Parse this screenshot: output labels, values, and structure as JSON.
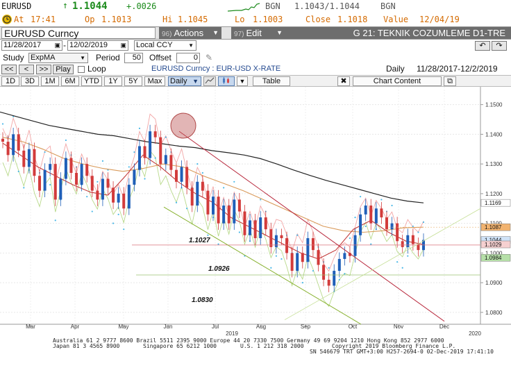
{
  "quote": {
    "ticker": "EURUSD",
    "last": "1.1044",
    "change": "+.0026",
    "bgn_label": "BGN",
    "bidask": "1.1043/1.1044",
    "bgn_label2": "BGN",
    "at_label": "At",
    "time": "17:41",
    "op_label": "Op",
    "open": "1.1013",
    "hi_label": "Hi",
    "high": "1.1045",
    "lo_label": "Lo",
    "low": "1.1003",
    "close_label": "Close",
    "close": "1.1018",
    "value_label": "Value",
    "value_date": "12/04/19"
  },
  "titlebar": {
    "security": "EURUSD Curncy",
    "actions_num": "96)",
    "actions_label": "Actions",
    "edit_num": "97)",
    "edit_label": "Edit",
    "function_title": "G 21: TEKNIK COZUMLEME D1-TRE"
  },
  "controls": {
    "start_date": "11/28/2017",
    "end_date": "12/02/2019",
    "currency": "Local CCY",
    "study_label": "Study",
    "study_value": "ExpMA",
    "period_label": "Period",
    "period_value": "50",
    "offset_label": "Offset",
    "offset_value": "0",
    "play_label": "Play",
    "loop_label": "Loop",
    "chart_subtitle": "EURUSD Curncy : EUR-USD X-RATE",
    "frequency": "Daily",
    "range_text": "11/28/2017-12/2/2019"
  },
  "periods": [
    "1D",
    "3D",
    "1M",
    "6M",
    "YTD",
    "1Y",
    "5Y",
    "Max"
  ],
  "toolbar": {
    "daily": "Daily",
    "table": "Table",
    "chart_content": "Chart Content"
  },
  "chart_data": {
    "type": "line",
    "x_ticks": [
      "Mar",
      "Apr",
      "May",
      "Jun",
      "Jul",
      "Aug",
      "Sep",
      "Oct",
      "Nov",
      "Dec"
    ],
    "year_ticks": [
      "2019",
      "2020"
    ],
    "y_ticks": [
      "1.1500",
      "1.1400",
      "1.1300",
      "1.1200",
      "1.1100",
      "1.1000",
      "1.0900",
      "1.0800"
    ],
    "ylim": [
      1.076,
      1.156
    ],
    "price_flags": [
      {
        "label": "1.1169",
        "value": 1.1169,
        "color": "#ffffff"
      },
      {
        "label": "1.1087",
        "value": 1.1087,
        "color": "#f2b36f"
      },
      {
        "label": "1.1044",
        "value": 1.1044,
        "color": "#cfe2f7"
      },
      {
        "label": "1.1029",
        "value": 1.1029,
        "color": "#f6d0d0"
      },
      {
        "label": "1.0984",
        "value": 1.0984,
        "color": "#b6e0a8"
      }
    ],
    "annotations": [
      "1.1027",
      "1.0926",
      "1.0830"
    ],
    "levels": [
      1.1027,
      1.0926,
      1.083
    ],
    "series": [
      {
        "role": "price",
        "values": [
          1.1375,
          1.133,
          1.14,
          1.1345,
          1.129,
          1.135,
          1.126,
          1.121,
          1.128,
          1.13,
          1.118,
          1.125,
          1.132,
          1.127,
          1.123,
          1.13,
          1.126,
          1.121,
          1.118,
          1.125,
          1.122,
          1.117,
          1.12,
          1.115,
          1.123,
          1.128,
          1.136,
          1.132,
          1.141,
          1.139,
          1.13,
          1.133,
          1.128,
          1.124,
          1.129,
          1.122,
          1.116,
          1.124,
          1.121,
          1.113,
          1.119,
          1.11,
          1.116,
          1.11,
          1.118,
          1.114,
          1.106,
          1.111,
          1.105,
          1.112,
          1.108,
          1.102,
          1.106,
          1.105,
          1.1,
          1.094,
          1.1,
          1.097,
          1.105,
          1.101,
          1.096,
          1.091,
          1.089,
          1.094,
          1.098,
          1.1,
          1.099,
          1.106,
          1.113,
          1.116,
          1.11,
          1.115,
          1.112,
          1.108,
          1.11,
          1.104,
          1.102,
          1.106,
          1.103,
          1.101,
          1.1044
        ]
      },
      {
        "role": "ema-long",
        "values": [
          1.1475,
          1.146,
          1.1445,
          1.143,
          1.142,
          1.141,
          1.14,
          1.1395,
          1.1385,
          1.1375,
          1.1368,
          1.136,
          1.1355,
          1.1345,
          1.1338,
          1.133,
          1.1318,
          1.13,
          1.128,
          1.1262,
          1.1245,
          1.123,
          1.1215,
          1.12,
          1.1185,
          1.1175,
          1.1169
        ]
      },
      {
        "role": "ema-mid",
        "values": [
          1.139,
          1.1375,
          1.135,
          1.132,
          1.13,
          1.1285,
          1.1275,
          1.1285,
          1.13,
          1.129,
          1.126,
          1.1235,
          1.121,
          1.118,
          1.115,
          1.112,
          1.109,
          1.1075,
          1.107,
          1.1075,
          1.1085,
          1.1087
        ]
      },
      {
        "role": "ema-short",
        "values": [
          1.137,
          1.133,
          1.129,
          1.126,
          1.123,
          1.1205,
          1.1195,
          1.126,
          1.133,
          1.129,
          1.124,
          1.12,
          1.117,
          1.112,
          1.109,
          1.106,
          1.103,
          1.1,
          1.098,
          1.101,
          1.108,
          1.111,
          1.107,
          1.104,
          1.1029
        ]
      }
    ]
  },
  "footer": {
    "line1": "Australia 61 2 9777 8600  Brazil 5511 2395 9000  Europe 44 20 7330 7500  Germany 49 69 9204 1210  Hong Kong 852 2977 6000",
    "line2a": "Japan 81 3 4565 8900",
    "line2b": "Singapore 65 6212 1000",
    "line2c": "U.S. 1 212 318 2000",
    "line2d": "Copyright 2019 Bloomberg Finance L.P.",
    "line3": "SN 546679 TRT  GMT+3:00 H257-2694-0 02-Dec-2019 17:41:10"
  }
}
